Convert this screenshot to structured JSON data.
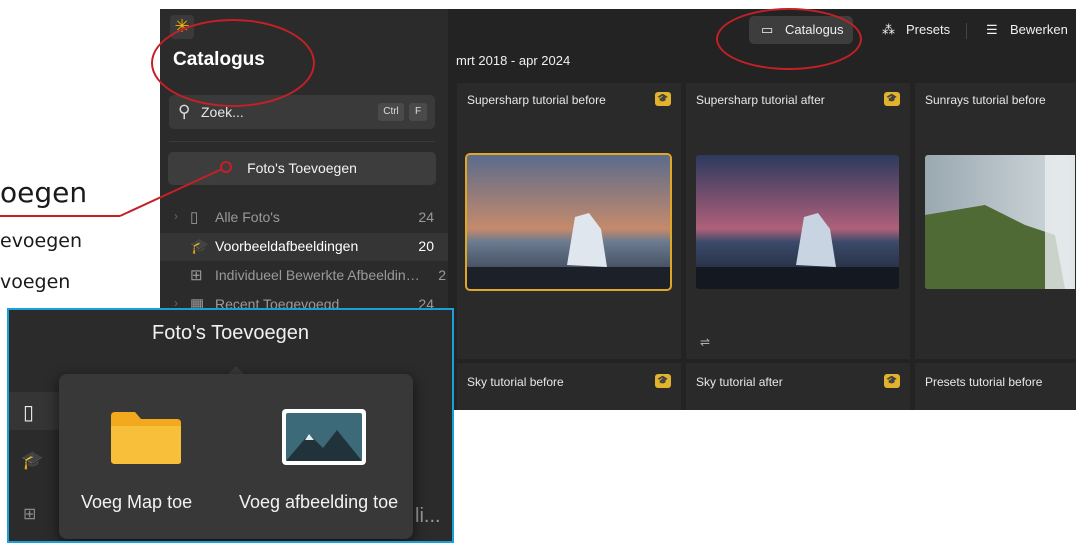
{
  "background_text": {
    "line1": "oegen",
    "line2": "evoegen",
    "line3": "voegen"
  },
  "sidebar": {
    "title": "Catalogus",
    "search_placeholder": "Zoek...",
    "shortcut_ctrl": "Ctrl",
    "shortcut_f": "F",
    "add_button": "Foto's Toevoegen",
    "items": [
      {
        "label": "Alle Foto's",
        "count": "24",
        "icon": "photo-stack-icon"
      },
      {
        "label": "Voorbeeldafbeeldingen",
        "count": "20",
        "icon": "graduation-cap-icon"
      },
      {
        "label": "Individueel Bewerkte Afbeeldingen",
        "count": "2",
        "icon": "grid-icon"
      },
      {
        "label": "Recent Toegevoegd",
        "count": "24",
        "icon": "calendar-icon"
      }
    ]
  },
  "topbar": {
    "catalogus": "Catalogus",
    "presets": "Presets",
    "bewerken": "Bewerken"
  },
  "date_range": "mrt 2018 - apr 2024",
  "photos": [
    {
      "title": "Supersharp tutorial before",
      "badge": "graduation-cap-icon",
      "selected": true
    },
    {
      "title": "Supersharp tutorial after",
      "badge": "graduation-cap-icon",
      "edited": true
    },
    {
      "title": "Sunrays tutorial before",
      "badge": "graduation-cap-icon"
    },
    {
      "title": "Sky tutorial before",
      "badge": "graduation-cap-icon"
    },
    {
      "title": "Sky tutorial after",
      "badge": "graduation-cap-icon"
    },
    {
      "title": "Presets tutorial before",
      "badge": "graduation-cap-icon"
    }
  ],
  "callout": {
    "title": "Foto's Toevoegen",
    "option_folder": "Voeg Map toe",
    "option_image": "Voeg afbeelding toe",
    "side_text": "li..."
  },
  "colors": {
    "accent": "#e2b32c",
    "annotation": "#c42026",
    "callout_border": "#1aa0d8"
  }
}
